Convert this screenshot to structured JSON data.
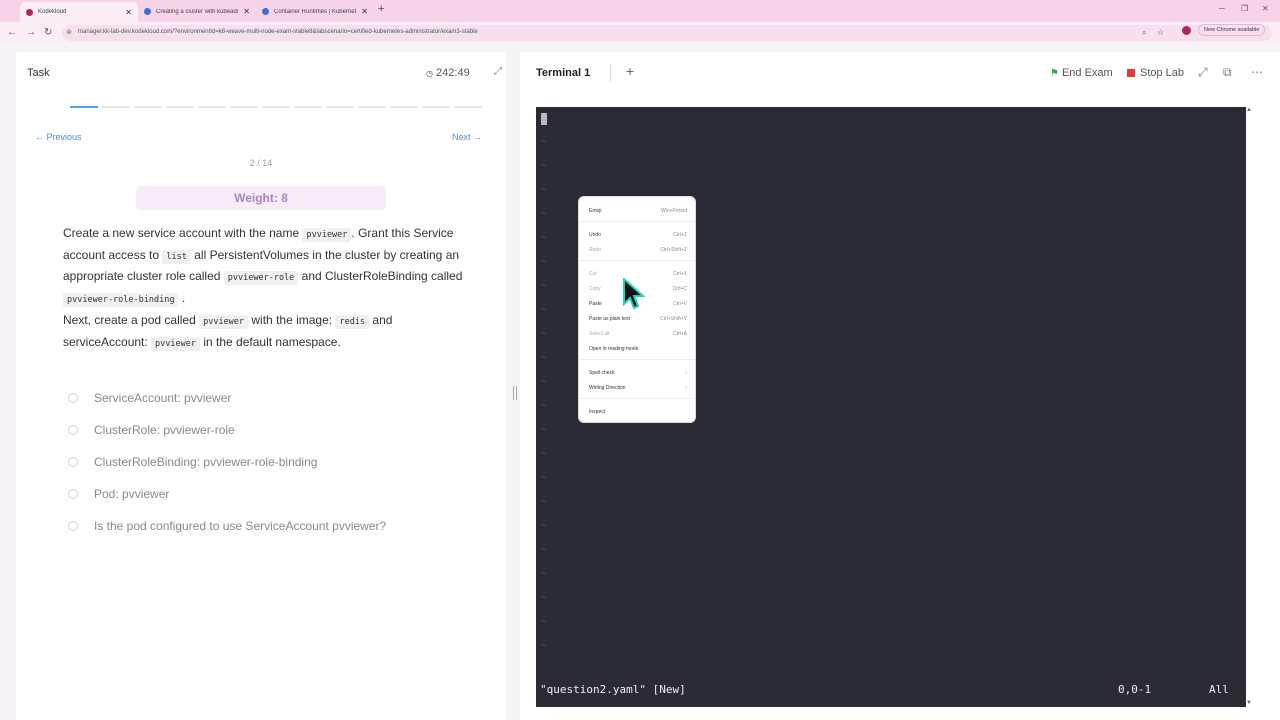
{
  "browser": {
    "tabs": [
      {
        "title": "Kodekloud",
        "active": true,
        "color": "#b4245a"
      },
      {
        "title": "Creating a cluster with kubeadm",
        "active": false,
        "color": "#3b6fd8"
      },
      {
        "title": "Container Runtimes | Kubernetes",
        "active": false,
        "color": "#3b6fd8"
      }
    ],
    "url": "manager.kk-lab-dev.kodekloud.com/?environmentId=k8-weave-multi-node-exam-stable8&labscenario=certified-kubernetes-administrator/exam3-stable",
    "new_chrome": "New Chrome available"
  },
  "task_panel": {
    "title": "Task",
    "timer": "242:49",
    "progress": {
      "current": 2,
      "total": 14
    },
    "previous": "Previous",
    "next": "Next",
    "counter": "2 / 14",
    "weight": "Weight: 8",
    "description": {
      "p1": "Create a new service account with the name",
      "c1": "pvviewer",
      "p2": ". Grant this Service account access to",
      "c2": "list",
      "p3": "all PersistentVolumes in the cluster by creating an appropriate cluster role called",
      "c3": "pvviewer-role",
      "p4": "and ClusterRoleBinding called",
      "c4": "pvviewer-role-binding",
      "p5": ".",
      "p6": "Next, create a pod called",
      "c5": "pvviewer",
      "p7": "with the image:",
      "c6": "redis",
      "p8": "and serviceAccount:",
      "c7": "pvviewer",
      "p9": "in the default namespace."
    },
    "checks": [
      "ServiceAccount: pvviewer",
      "ClusterRole: pvviewer-role",
      "ClusterRoleBinding: pvviewer-role-binding",
      "Pod: pvviewer",
      "Is the pod configured to use ServiceAccount pvviewer?"
    ]
  },
  "terminal_panel": {
    "tab": "Terminal 1",
    "end_exam": "End Exam",
    "stop_lab": "Stop Lab",
    "status_file": "\"question2.yaml\" [New]",
    "status_pos": "0,0-1",
    "status_all": "All"
  },
  "context_menu": [
    {
      "label": "Emoji",
      "shortcut": "Win+Period",
      "dim": false
    },
    {
      "label": "Undo",
      "shortcut": "Ctrl+Z",
      "dim": false
    },
    {
      "label": "Redo",
      "shortcut": "Ctrl+Shift+Z",
      "dim": true
    },
    {
      "label": "Cut",
      "shortcut": "Ctrl+X",
      "dim": true
    },
    {
      "label": "Copy",
      "shortcut": "Ctrl+C",
      "dim": true
    },
    {
      "label": "Paste",
      "shortcut": "Ctrl+V",
      "dim": false
    },
    {
      "label": "Paste as plain text",
      "shortcut": "Ctrl+Shift+V",
      "dim": false
    },
    {
      "label": "Select all",
      "shortcut": "Ctrl+A",
      "dim": true
    },
    {
      "label": "Open in reading mode",
      "shortcut": "",
      "dim": false
    },
    {
      "label": "Spell check",
      "shortcut": "›",
      "dim": false
    },
    {
      "label": "Writing Direction",
      "shortcut": "›",
      "dim": false
    },
    {
      "label": "Inspect",
      "shortcut": "",
      "dim": false
    }
  ]
}
